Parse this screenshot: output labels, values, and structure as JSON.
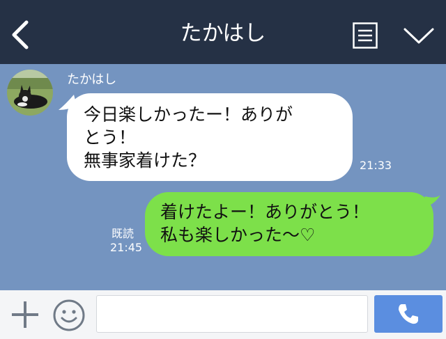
{
  "header": {
    "title": "たかはし"
  },
  "messages": [
    {
      "direction": "incoming",
      "sender": "たかはし",
      "text": "今日楽しかったー！ありが\nとう！\n無事家着けた？",
      "time": "21:33"
    },
    {
      "direction": "outgoing",
      "text": "着けたよー！ありがとう！\n私も楽しかった〜♡",
      "read_label": "既読",
      "time": "21:45"
    }
  ],
  "input": {
    "value": "",
    "placeholder": ""
  },
  "icons": [
    "back-arrow-icon",
    "menu-icon",
    "chevron-down-icon",
    "plus-icon",
    "smiley-icon",
    "phone-icon"
  ],
  "colors": {
    "header": "#253145",
    "chat_background": "#7494c0",
    "incoming_bubble": "#ffffff",
    "outgoing_bubble": "#7de04a",
    "send_button": "#5b8ee0"
  }
}
